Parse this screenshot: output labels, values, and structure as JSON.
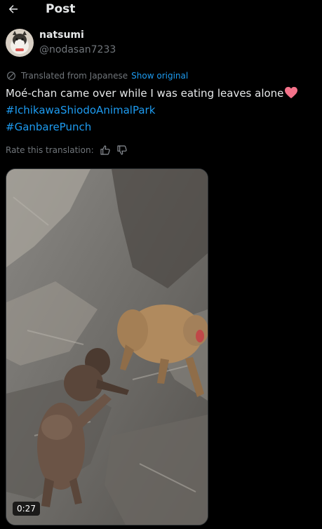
{
  "header": {
    "back_icon": "arrow-left-icon",
    "title": "Post"
  },
  "author": {
    "name": "natsumi",
    "handle": "@nodasan7233"
  },
  "translation": {
    "notice": "Translated from Japanese",
    "show_original": "Show original",
    "rate_label": "Rate this translation:"
  },
  "post": {
    "text": "Moé-chan came over while I was eating leaves alone",
    "hashtags": [
      "#IchikawaShiodoAnimalPark",
      "#GanbarePunch"
    ]
  },
  "media": {
    "duration": "0:27"
  },
  "colors": {
    "background": "#000000",
    "text": "#e7e9ea",
    "secondary": "#71767b",
    "link": "#1d9bf0",
    "heart": "#f4728a"
  }
}
